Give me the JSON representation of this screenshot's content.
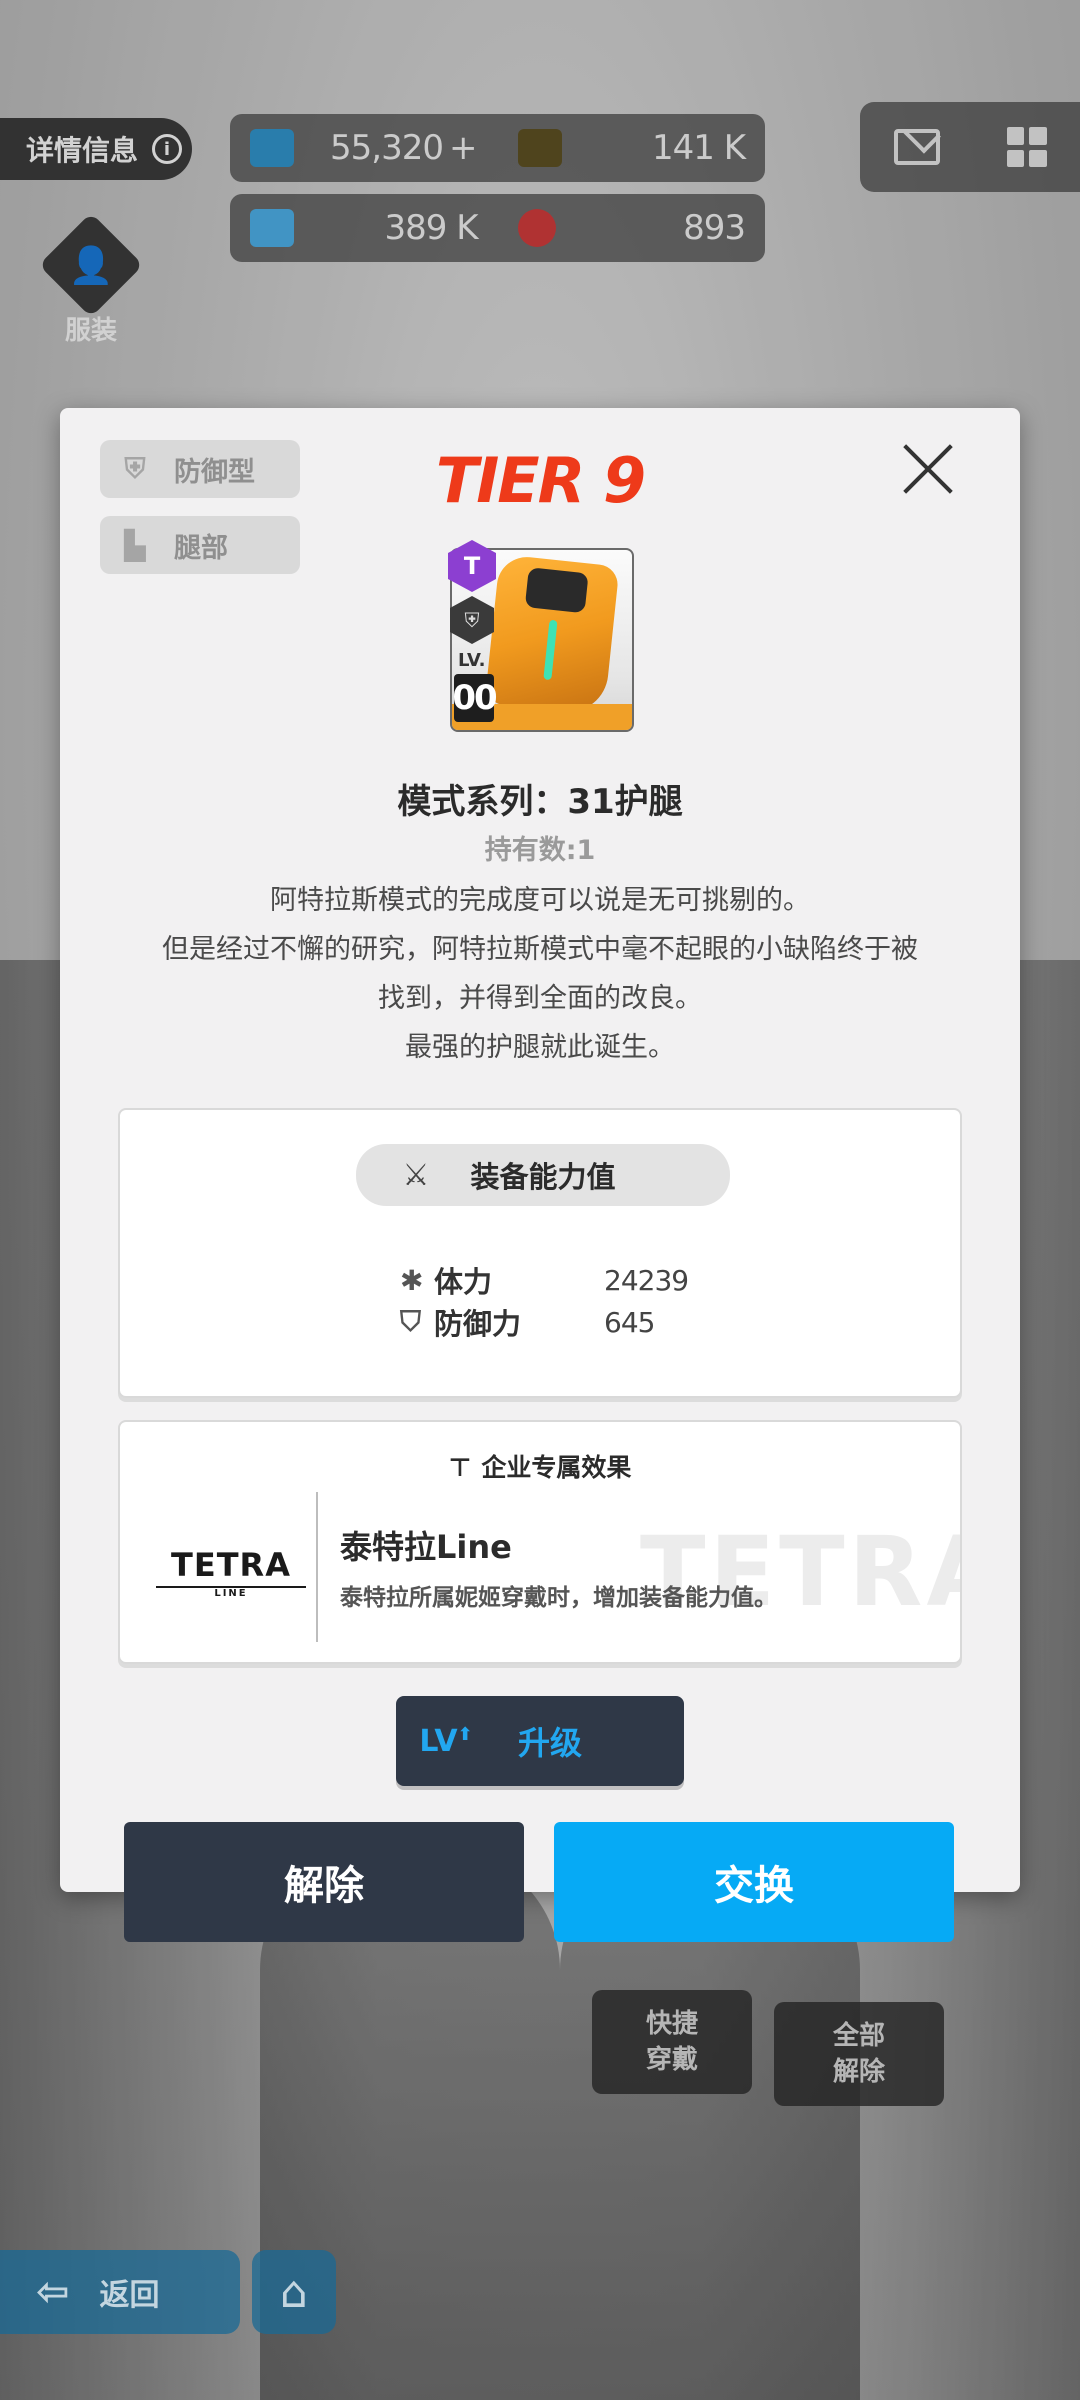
{
  "hud": {
    "info_label": "详情信息",
    "info_icon": "info-icon",
    "resources": [
      {
        "icon": "crystal-icon",
        "value": "55,320",
        "plus": "+",
        "color": "#2f8fc4"
      },
      {
        "icon": "credit-card-icon",
        "value": "141 K",
        "color": "#7a6a2a"
      },
      {
        "icon": "battle-data-icon",
        "value": "389 K",
        "color": "#4aa9e0"
      },
      {
        "icon": "core-dust-icon",
        "value": "893",
        "color": "#c93a3a"
      }
    ],
    "costume_label": "服装"
  },
  "modal": {
    "type_tag": "防御型",
    "slot_tag": "腿部",
    "tier": "TIER 9",
    "item": {
      "badge": "T",
      "level_label": "LV.",
      "level_value": "00",
      "name": "模式系列：31护腿",
      "owned": "持有数:1"
    },
    "description": [
      "阿特拉斯模式的完成度可以说是无可挑剔的。",
      "但是经过不懈的研究，阿特拉斯模式中毫不起眼的小缺陷终于被",
      "找到，并得到全面的改良。",
      "最强的护腿就此诞生。"
    ],
    "stats": {
      "title": "装备能力值",
      "rows": [
        {
          "icon": "hp-asterisk-icon",
          "label": "体力",
          "value": "24239"
        },
        {
          "icon": "shield-icon",
          "label": "防御力",
          "value": "645"
        }
      ]
    },
    "corp": {
      "title": "企业专属效果",
      "logo": "TETRA",
      "logo_sub": "LINE",
      "name": "泰特拉Line",
      "desc": "泰特拉所属妮姬穿戴时，增加装备能力值。",
      "watermark": "TETRA"
    },
    "upgrade": {
      "icon_text": "LV",
      "label": "升级"
    },
    "release_label": "解除",
    "swap_label": "交换"
  },
  "background": {
    "quick_equip_line1": "快捷",
    "quick_equip_line2": "穿戴",
    "remove_all_line1": "全部",
    "remove_all_line2": "解除",
    "back_label": "返回"
  }
}
